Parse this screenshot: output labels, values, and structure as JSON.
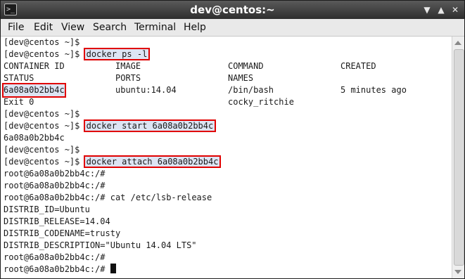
{
  "window": {
    "title": "dev@centos:~"
  },
  "menu": [
    "File",
    "Edit",
    "View",
    "Search",
    "Terminal",
    "Help"
  ],
  "terminal": {
    "prompt": "[dev@centos ~]$",
    "cmd1": "docker ps -l",
    "table": {
      "headers1": [
        "CONTAINER ID",
        "IMAGE",
        "COMMAND",
        "CREATED"
      ],
      "headers2": [
        "STATUS",
        "PORTS",
        "NAMES"
      ],
      "row": [
        "6a08a0b2bb4c",
        "ubuntu:14.04",
        "/bin/bash",
        "5 minutes ago"
      ],
      "row2": [
        "Exit 0",
        "cocky_ritchie"
      ]
    },
    "cmd2": "docker start 6a08a0b2bb4c",
    "out2": "6a08a0b2bb4c",
    "cmd3": "docker attach 6a08a0b2bb4c",
    "root_prompt": "root@6a08a0b2bb4c:/#",
    "cmd4": "cat /etc/lsb-release",
    "lsb": [
      "DISTRIB_ID=Ubuntu",
      "DISTRIB_RELEASE=14.04",
      "DISTRIB_CODENAME=trusty",
      "DISTRIB_DESCRIPTION=\"Ubuntu 14.04 LTS\""
    ]
  }
}
